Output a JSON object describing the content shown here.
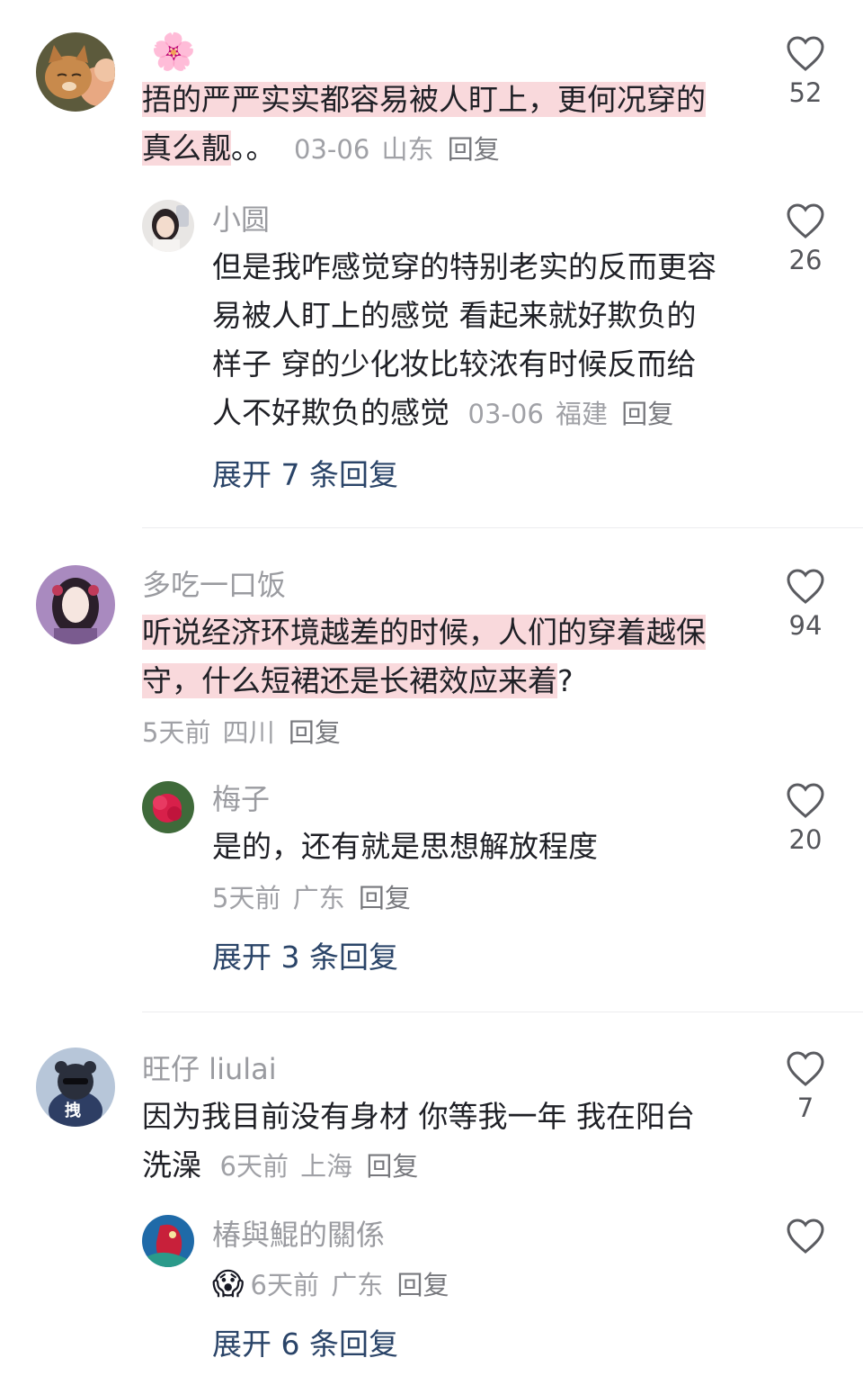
{
  "comments": [
    {
      "avatar_icon": "cat-with-flowers-avatar",
      "username_emoji": "🌸",
      "text_highlight_1": "捂的严严实实都容易被人盯上，更何况穿的",
      "text_highlight_2": "真么靓",
      "text_tail": "。。",
      "time": "03-06",
      "location": "山东",
      "reply_label": "回复",
      "likes": "52",
      "sub": {
        "username": "小圆",
        "text_lines": [
          "但是我咋感觉穿的特别老实的反而更容",
          "易被人盯上的感觉 看起来就好欺负的",
          "样子 穿的少化妆比较浓有时候反而给",
          "人不好欺负的感觉"
        ],
        "time": "03-06",
        "location": "福建",
        "reply_label": "回复",
        "likes": "26"
      },
      "expand_label": "展开 7 条回复"
    },
    {
      "avatar_icon": "illustrated-woman-avatar",
      "username": "多吃一口饭",
      "text_highlight_1": "听说经济环境越差的时候，人们的穿着越保",
      "text_highlight_2": "守，什么短裙还是长裙效应来着",
      "text_tail": "?",
      "time": "5天前",
      "location": "四川",
      "reply_label": "回复",
      "likes": "94",
      "sub": {
        "username": "梅子",
        "text": "是的，还有就是思想解放程度",
        "time": "5天前",
        "location": "广东",
        "reply_label": "回复",
        "likes": "20"
      },
      "expand_label": "展开 3 条回复"
    },
    {
      "avatar_icon": "bear-avatar",
      "avatar_text": "拽",
      "username": "旺仔 liulai",
      "text_line_1": "因为我目前没有身材 你等我一年 我在阳台",
      "text_line_2": "洗澡",
      "time": "6天前",
      "location": "上海",
      "reply_label": "回复",
      "likes": "7",
      "sub": {
        "username": "椿與鯤的關係",
        "emoji": "😱",
        "time": "6天前",
        "location": "广东",
        "reply_label": "回复",
        "likes": ""
      },
      "expand_label": "展开 6 条回复"
    }
  ],
  "colors": {
    "highlight": "#f9d9dc",
    "link": "#2a4468",
    "meta": "#a0a1a6"
  }
}
